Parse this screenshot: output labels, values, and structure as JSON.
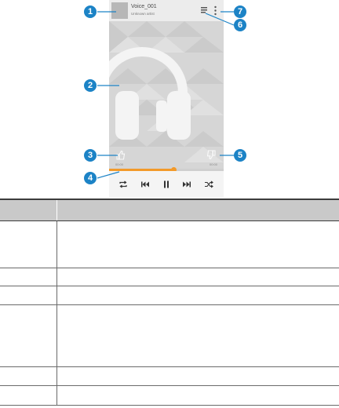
{
  "player": {
    "track_title": "Voice_001",
    "track_artist": "Unknown artist",
    "time_elapsed": "00:00",
    "time_total": "00:00",
    "progress_fraction": 0.56,
    "accent_color": "#f39a2a",
    "icons": [
      "album-art",
      "playlist-icon",
      "more-options-icon",
      "headphones-art",
      "thumbs-up-icon",
      "thumbs-down-icon",
      "repeat-icon",
      "previous-icon",
      "pause-icon",
      "next-icon",
      "shuffle-icon"
    ]
  },
  "callouts": [
    "1",
    "2",
    "3",
    "4",
    "5",
    "6",
    "7"
  ],
  "callout_color": "#1c83c6",
  "table": {
    "header": [
      "",
      ""
    ],
    "rows": [
      [
        "",
        ""
      ],
      [
        "",
        ""
      ],
      [
        "",
        ""
      ],
      [
        "",
        ""
      ],
      [
        "",
        ""
      ],
      [
        "",
        ""
      ]
    ]
  }
}
